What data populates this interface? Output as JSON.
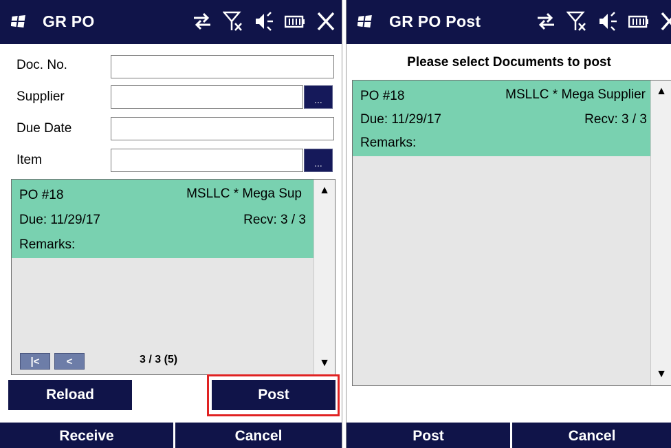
{
  "left_screen": {
    "title": "GR PO",
    "fields": [
      {
        "label": "Doc. No.",
        "value": ""
      },
      {
        "label": "Supplier",
        "value": ""
      },
      {
        "label": "Due Date",
        "value": ""
      },
      {
        "label": "Item",
        "value": ""
      }
    ],
    "lookup_label": "...",
    "record": {
      "po": "PO #18",
      "supplier": "MSLLC * Mega Sup",
      "due": "Due: 11/29/17",
      "recv": "Recv: 3 / 3",
      "remarks": "Remarks:"
    },
    "pager": {
      "first": "|<",
      "prev": "<",
      "status": "3 / 3 (5)"
    },
    "buttons": {
      "reload": "Reload",
      "post": "Post",
      "receive": "Receive",
      "cancel": "Cancel"
    }
  },
  "right_screen": {
    "title": "GR PO Post",
    "prompt": "Please select Documents to post",
    "record": {
      "po": "PO #18",
      "supplier": "MSLLC * Mega Supplier",
      "due": "Due: 11/29/17",
      "recv": "Recv: 3 / 3",
      "remarks": "Remarks:"
    },
    "buttons": {
      "post": "Post",
      "cancel": "Cancel"
    }
  },
  "status_icons": [
    "sync-icon",
    "no-signal-icon",
    "volume-icon",
    "battery-icon",
    "close-icon"
  ],
  "colors": {
    "titlebar": "#101449",
    "record_bg": "#79d1b0",
    "list_bg": "#e6e6e6",
    "highlight": "#e02222"
  }
}
